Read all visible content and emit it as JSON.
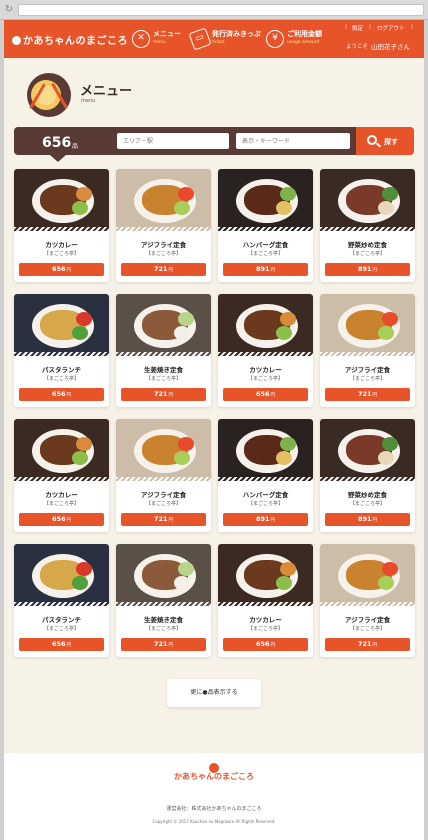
{
  "header": {
    "logo_text": "かあちゃんのまごころ",
    "nav": [
      {
        "label": "メニュー",
        "sub": "menu",
        "icon": "menu-icon"
      },
      {
        "label": "発行済みきっぷ",
        "sub": "ticket",
        "icon": "ticket-icon"
      },
      {
        "label": "ご利用金額",
        "sub": "usage amount",
        "icon": "yen-icon"
      }
    ],
    "settings_label": "設定",
    "logout_label": "ログアウト",
    "welcome_label": "ようこそ",
    "user_name": "山田花子さん"
  },
  "title": {
    "main": "メニュー",
    "sub": "menu"
  },
  "search": {
    "count": "656",
    "count_unit": "品",
    "area_placeholder": "エリア・駅",
    "keyword_placeholder": "表示・キーワード",
    "button_label": "探す"
  },
  "shop_label": "【まごころ亭】",
  "yen_unit": "円",
  "cards": [
    {
      "name": "カツカレー",
      "price": "656",
      "dish": "katsu"
    },
    {
      "name": "アジフライ定食",
      "price": "721",
      "dish": "fry"
    },
    {
      "name": "ハンバーグ定食",
      "price": "891",
      "dish": "hamburg"
    },
    {
      "name": "野菜炒め定食",
      "price": "891",
      "dish": "yasai"
    },
    {
      "name": "パスタランチ",
      "price": "656",
      "dish": "pasta"
    },
    {
      "name": "生姜焼き定食",
      "price": "721",
      "dish": "ginger"
    },
    {
      "name": "カツカレー",
      "price": "656",
      "dish": "katsu"
    },
    {
      "name": "アジフライ定食",
      "price": "721",
      "dish": "fry"
    },
    {
      "name": "カツカレー",
      "price": "656",
      "dish": "katsu"
    },
    {
      "name": "アジフライ定食",
      "price": "721",
      "dish": "fry"
    },
    {
      "name": "ハンバーグ定食",
      "price": "891",
      "dish": "hamburg"
    },
    {
      "name": "野菜炒め定食",
      "price": "891",
      "dish": "yasai"
    },
    {
      "name": "パスタランチ",
      "price": "656",
      "dish": "pasta"
    },
    {
      "name": "生姜焼き定食",
      "price": "721",
      "dish": "ginger"
    },
    {
      "name": "カツカレー",
      "price": "656",
      "dish": "katsu"
    },
    {
      "name": "アジフライ定食",
      "price": "721",
      "dish": "fry"
    }
  ],
  "more_label": "更に●品表示する",
  "footer": {
    "logo_text": "かあちゃんのまごころ",
    "operator": "運営会社：株式会社かあちゃんのまごころ",
    "copyright": "Copyright © 2017 Kaachan no Magokoro All Rights Reserved."
  },
  "colors": {
    "brand": "#e8542a",
    "dark": "#5a3a34",
    "background": "#f7f2e8"
  }
}
